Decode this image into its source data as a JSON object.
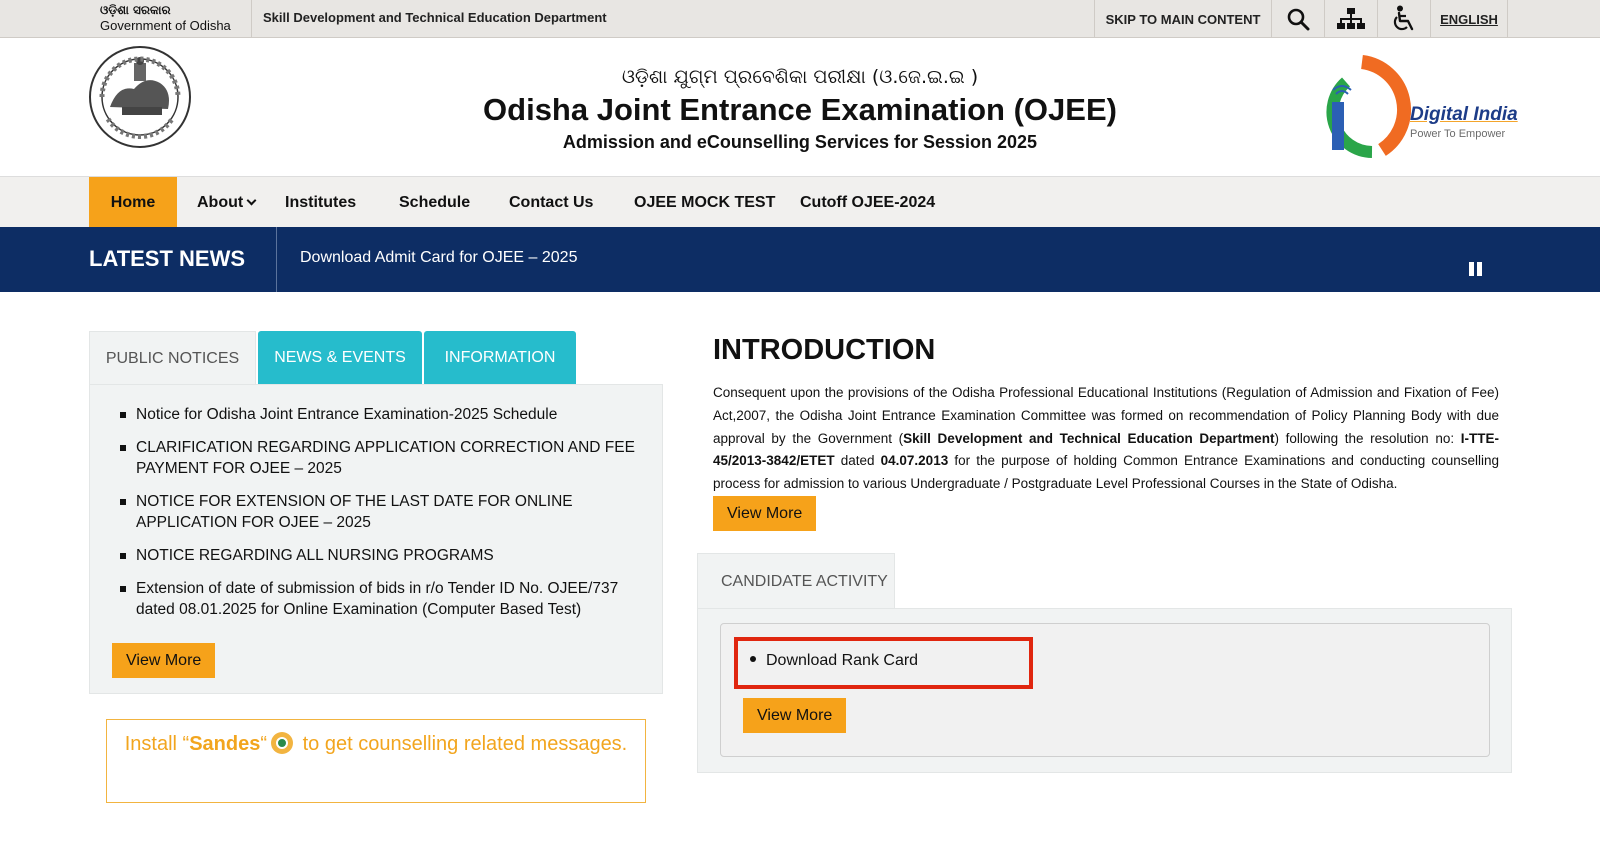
{
  "topbar": {
    "gov_odia": "ଓଡ଼ିଶା ସରକାର",
    "gov_english": "Government of Odisha",
    "department": "Skill Development and Technical Education Department",
    "skip": "SKIP TO MAIN CONTENT",
    "language": "ENGLISH",
    "icons": [
      "search-icon",
      "sitemap-icon",
      "accessibility-icon"
    ]
  },
  "header": {
    "title_odia": "ଓଡ଼ିଶା ଯୁଗ୍ମ ପ୍ରବେଶିକା ପରୀକ୍ଷା (ଓ.ଜେ.ଇ.ଇ )",
    "title": "Odisha Joint Entrance Examination (OJEE)",
    "subtitle": "Admission and eCounselling Services for Session 2025",
    "digital_india": "Digital India",
    "digital_india_tagline": "Power To Empower"
  },
  "nav": {
    "items": [
      "Home",
      "About",
      "Institutes",
      "Schedule",
      "Contact Us",
      "OJEE MOCK TEST",
      "Cutoff OJEE-2024"
    ],
    "active": "Home"
  },
  "news": {
    "label": "LATEST NEWS",
    "text": "Download Admit Card for OJEE – 2025"
  },
  "notices": {
    "tabs": [
      "PUBLIC NOTICES",
      "NEWS & EVENTS",
      "INFORMATION"
    ],
    "active_tab": "PUBLIC NOTICES",
    "items": [
      "Notice for Odisha Joint Entrance Examination-2025 Schedule",
      "CLARIFICATION REGARDING APPLICATION CORRECTION AND FEE PAYMENT FOR OJEE – 2025",
      "NOTICE FOR EXTENSION OF THE LAST DATE FOR ONLINE APPLICATION FOR OJEE – 2025",
      "NOTICE REGARDING ALL NURSING PROGRAMS",
      "Extension of date of submission of bids in r/o Tender ID No. OJEE/737 dated 08.01.2025 for Online Examination (Computer Based Test)"
    ],
    "view_more": "View More"
  },
  "sandes": {
    "prefix": "Install “",
    "name": "Sandes",
    "mid": "“",
    "suffix": " to get counselling related messages."
  },
  "intro": {
    "heading": "INTRODUCTION",
    "p1": "Consequent upon the provisions of the Odisha Professional Educational Institutions (Regulation of Admission and Fixation of Fee) Act,2007, the Odisha Joint Entrance Examination Committee was formed on recommendation of Policy Planning Body with due approval by the Government (",
    "dept_bold": "Skill Development and Technical Education Department",
    "p2": ") following the resolution no: ",
    "resolution_bold": "I-TTE-45/2013-3842/ETET",
    "p3": " dated ",
    "date_bold": "04.07.2013",
    "p4": " for the purpose of holding Common Entrance Examinations and conducting counselling process for admission to various Undergraduate / Postgraduate Level Professional Courses in the State of Odisha.",
    "view_more": "View More"
  },
  "candidate": {
    "tab": "CANDIDATE ACTIVITY",
    "items": [
      "Download Rank Card"
    ],
    "view_more": "View More",
    "highlight_color": "#e0260f"
  },
  "colors": {
    "accent": "#f6a21a",
    "navy": "#0d2d64",
    "teal": "#26bccc"
  }
}
